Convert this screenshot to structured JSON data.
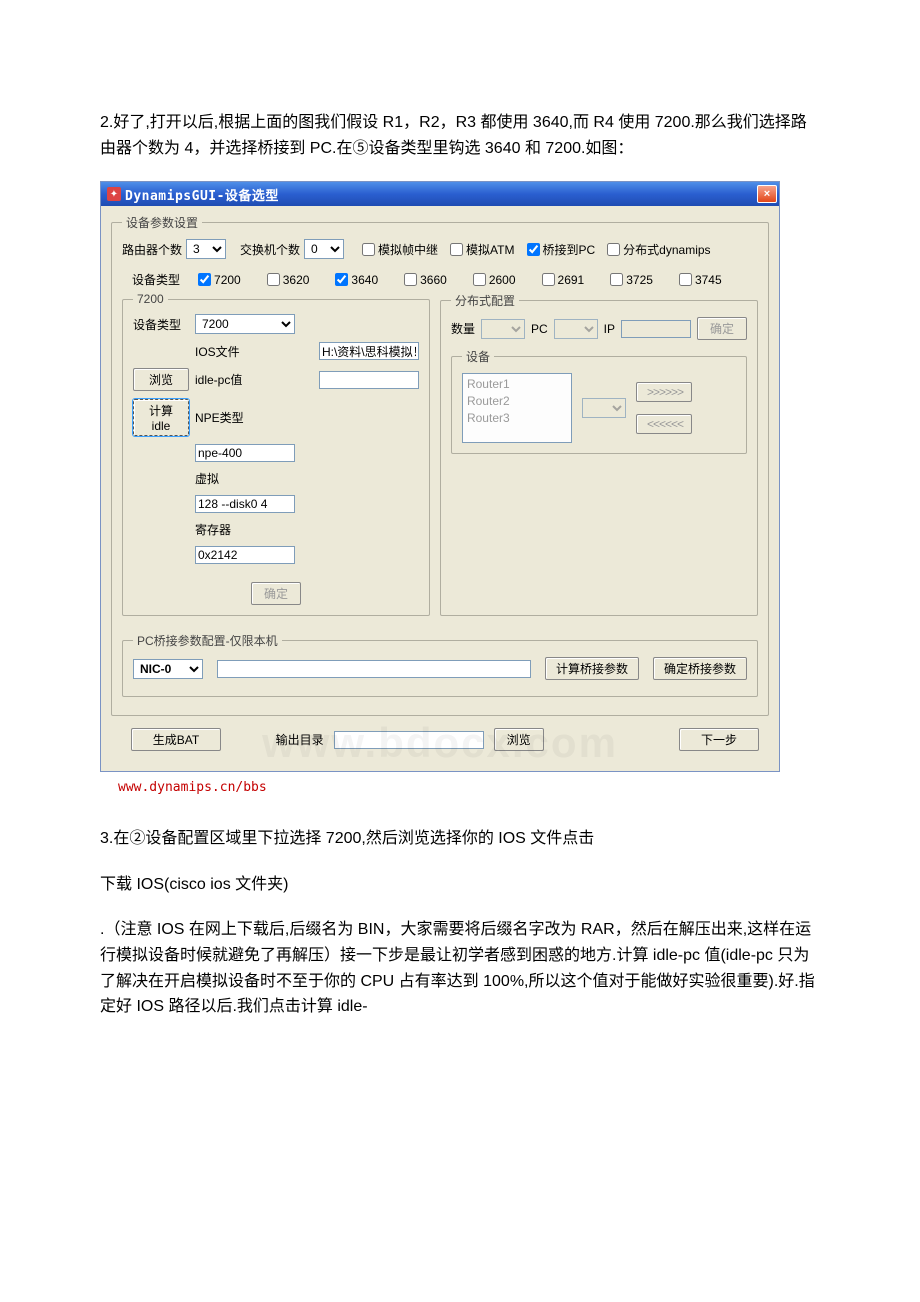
{
  "doc": {
    "para2": "2.好了,打开以后,根据上面的图我们假设 R1，R2，R3 都使用 3640,而 R4 使用 7200.那么我们选择路由器个数为 4，并选择桥接到 PC.在⑤设备类型里钩选 3640 和 7200.如图：",
    "para3": "3.在②设备配置区域里下拉选择 7200,然后浏览选择你的 IOS 文件点击",
    "para_dl": "下载 IOS(cisco ios 文件夹)",
    "para_note": ".（注意 IOS 在网上下载后,后缀名为 BIN，大家需要将后缀名字改为 RAR，然后在解压出来,这样在运行模拟设备时候就避免了再解压）接一下步是最让初学者感到困惑的地方.计算 idle-pc 值(idle-pc 只为了解决在开启模拟设备时不至于你的 CPU 占有率达到 100%,所以这个值对于能做好实验很重要).好.指定好 IOS 路径以后.我们点击计算 idle-"
  },
  "window": {
    "title": "DynamipsGUI-设备选型",
    "close": "×"
  },
  "params": {
    "legend": "设备参数设置",
    "router_count_label": "路由器个数",
    "router_count_value": "3",
    "switch_count_label": "交换机个数",
    "switch_count_value": "0",
    "chk_frame": "模拟帧中继",
    "chk_atm": "模拟ATM",
    "chk_bridge": "桥接到PC",
    "chk_dist": "分布式dynamips",
    "devtype_label": "设备类型",
    "types": {
      "t7200": "7200",
      "t3620": "3620",
      "t3640": "3640",
      "t3660": "3660",
      "t2600": "2600",
      "t2691": "2691",
      "t3725": "3725",
      "t3745": "3745"
    }
  },
  "cfg7200": {
    "legend": "7200",
    "devtype_label": "设备类型",
    "devtype_value": "7200",
    "ios_label": "IOS文件",
    "ios_value": "H:\\资料\\思科模拟！",
    "browse": "浏览",
    "idle_label": "idle-pc值",
    "idle_value": "",
    "calc_idle": "计算idle",
    "npe_label": "NPE类型",
    "npe_value": "npe-400",
    "virt_label": "虚拟",
    "virt_value": "128 --disk0 4",
    "reg_label": "寄存器",
    "reg_value": "0x2142",
    "ok": "确定"
  },
  "dist": {
    "legend": "分布式配置",
    "qty_label": "数量",
    "pc_label": "PC",
    "ip_label": "IP",
    "ok": "确定",
    "dev_legend": "设备",
    "routers": [
      "Router1",
      "Router2",
      "Router3"
    ],
    "btn_right": ">>>>>>",
    "btn_left": "<<<<<<"
  },
  "bridge": {
    "legend": "PC桥接参数配置-仅限本机",
    "nic_value": "NIC-0",
    "calc_btn": "计算桥接参数",
    "ok_btn": "确定桥接参数"
  },
  "footer": {
    "gen_bat": "生成BAT",
    "out_dir": "输出目录",
    "browse": "浏览",
    "next": "下一步",
    "url": "www.dynamips.cn/bbs"
  },
  "watermark": "www.bdocx.com"
}
